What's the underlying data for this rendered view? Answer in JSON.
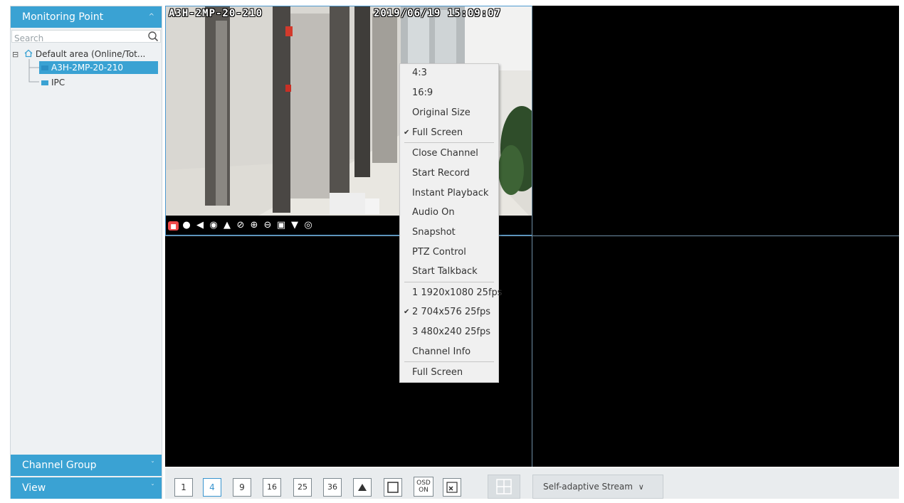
{
  "sidebar": {
    "monitoring_header": "Monitoring Point",
    "search_placeholder": "Search",
    "tree": {
      "area": "Default area (Online/Tot...",
      "channels": [
        "A3H-2MP-20-210",
        "IPC"
      ]
    },
    "channel_group_header": "Channel Group",
    "view_header": "View"
  },
  "video": {
    "channel_osd": "A3H-2MP-20-210",
    "timestamp_osd": "2019/06/19 15:09:07",
    "toolbar_icons": [
      "close-stream-icon",
      "record-icon",
      "audio-icon",
      "snapshot-icon",
      "ptz-icon",
      "zoom-reset-icon",
      "zoom-in-icon",
      "zoom-out-icon",
      "fullscreen-icon",
      "microphone-icon",
      "location-icon"
    ]
  },
  "context_menu": {
    "items": [
      {
        "label": "4:3",
        "checked": false
      },
      {
        "label": "16:9",
        "checked": false
      },
      {
        "label": "Original Size",
        "checked": false
      },
      {
        "label": "Full Screen",
        "checked": true
      },
      {
        "label": "Close Channel",
        "checked": false
      },
      {
        "label": "Start Record",
        "checked": false
      },
      {
        "label": "Instant Playback",
        "checked": false
      },
      {
        "label": "Audio On",
        "checked": false
      },
      {
        "label": "Snapshot",
        "checked": false
      },
      {
        "label": "PTZ Control",
        "checked": false
      },
      {
        "label": "Start Talkback",
        "checked": false
      },
      {
        "label": "1 1920x1080 25fps",
        "checked": false
      },
      {
        "label": "2 704x576 25fps",
        "checked": true
      },
      {
        "label": "3 480x240 25fps",
        "checked": false
      },
      {
        "label": "Channel Info",
        "checked": false
      },
      {
        "label": "Full Screen",
        "checked": false
      }
    ]
  },
  "bottom_bar": {
    "layouts": [
      "1",
      "4",
      "9",
      "16",
      "25",
      "36"
    ],
    "active_layout": "4",
    "osd_button": "OSD\nON",
    "stream_label": "Self-adaptive Stream"
  },
  "colors": {
    "accent": "#3aa2d3",
    "sidebar_bg": "#eef1f3",
    "video_bg": "#000000"
  }
}
